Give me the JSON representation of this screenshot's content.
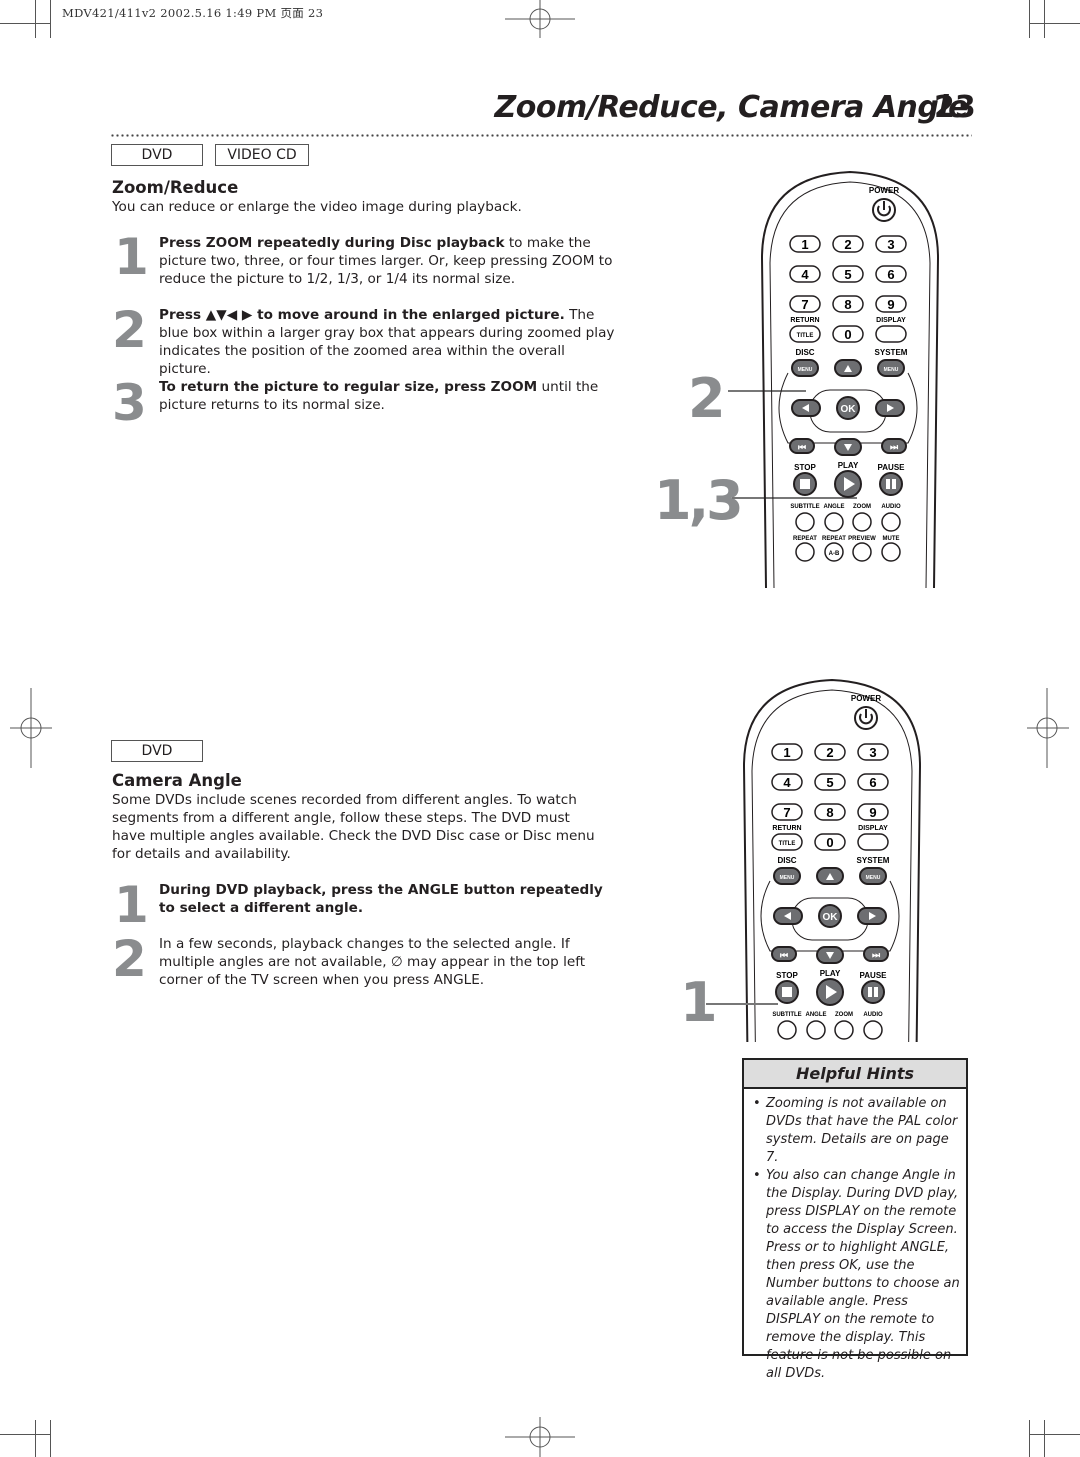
{
  "header_meta": "MDV421/411v2  2002.5.16  1:49 PM  页面 23",
  "page": {
    "title": "Zoom/Reduce, Camera Angle",
    "number": "23"
  },
  "zoom_section": {
    "tags": [
      "DVD",
      "VIDEO CD"
    ],
    "title": "Zoom/Reduce",
    "intro": "You can reduce or enlarge the video image during playback.",
    "steps": [
      {
        "num": "1",
        "bold": "Press ZOOM repeatedly during Disc playback",
        "text": " to make the picture two, three, or four times larger. Or, keep pressing ZOOM to reduce the picture to 1/2, 1/3, or 1/4 its normal size."
      },
      {
        "num": "2",
        "bold": "Press ▲▼◀ ▶ to move around in the enlarged picture.",
        "text": " The blue box within a larger gray box that appears during zoomed play indicates the position of the zoomed area within the overall picture."
      },
      {
        "num": "3",
        "bold": "To return the picture to regular size, press ZOOM",
        "text": " until the picture returns to its normal size."
      }
    ],
    "callouts": [
      "2",
      "1,3"
    ]
  },
  "angle_section": {
    "tags": [
      "DVD"
    ],
    "title": "Camera Angle",
    "intro": "Some DVDs include scenes recorded from different angles. To watch segments from a different angle, follow these steps. The DVD must have multiple angles available. Check the DVD Disc case or Disc menu for details and availability.",
    "steps": [
      {
        "num": "1",
        "bold": "During DVD playback, press the ANGLE button repeatedly to select a different angle.",
        "text": ""
      },
      {
        "num": "2",
        "bold": "",
        "text": "In a few seconds, playback changes to the selected angle. If multiple angles are not available, ∅ may appear in the top left corner of the TV screen when you press ANGLE."
      }
    ],
    "callouts": [
      "1"
    ]
  },
  "remote": {
    "power": "POWER",
    "digits": [
      "1",
      "2",
      "3",
      "4",
      "5",
      "6",
      "7",
      "8",
      "9",
      "0"
    ],
    "return_label": "RETURN",
    "title_label": "TITLE",
    "display_label": "DISPLAY",
    "disc_label": "DISC",
    "system_label": "SYSTEM",
    "menu_label": "MENU",
    "ok_label": "OK",
    "stop_label": "STOP",
    "play_label": "PLAY",
    "pause_label": "PAUSE",
    "row1_labels": [
      "SUBTITLE",
      "ANGLE",
      "ZOOM",
      "AUDIO"
    ],
    "row2_labels": [
      "REPEAT",
      "REPEAT",
      "PREVIEW",
      "MUTE"
    ],
    "ab_label": "A-B"
  },
  "hints": {
    "title": "Helpful Hints",
    "items": [
      "Zooming is not available on DVDs that have the PAL color system. Details are on page 7.",
      "You also can change Angle in the Display. During DVD play, press DISPLAY on the remote to access the Display Screen. Press or to highlight ANGLE, then press OK, use the Number buttons to choose an available angle. Press DISPLAY on the remote to remove the display. This feature is not be possible on all DVDs."
    ]
  }
}
